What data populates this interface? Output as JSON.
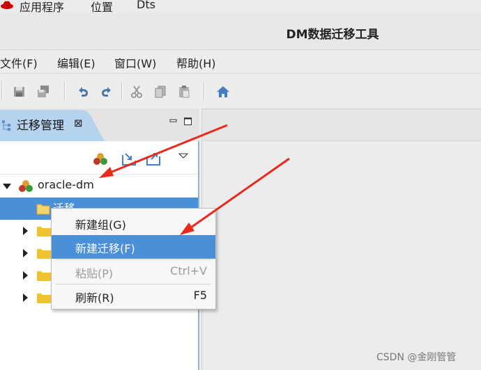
{
  "system_bar": {
    "applications": "应用程序",
    "places": "位置",
    "app_name": "Dts"
  },
  "window": {
    "title": "DM数据迁移工具"
  },
  "menubar": {
    "items": [
      "文件(F)",
      "编辑(E)",
      "窗口(W)",
      "帮助(H)"
    ]
  },
  "toolbar": {
    "icons": [
      "save-icon",
      "save-all-icon",
      "undo-icon",
      "redo-icon",
      "cut-icon",
      "copy-icon",
      "paste-icon",
      "home-icon"
    ]
  },
  "view": {
    "tab_label": "迁移管理",
    "tab_close": "⊠"
  },
  "tree": {
    "root_label": "oracle-dm",
    "selected_child_label": "迁移"
  },
  "context_menu": {
    "items": [
      {
        "label": "新建组(G)",
        "shortcut": ""
      },
      {
        "label": "新建迁移(F)",
        "shortcut": ""
      },
      {
        "label": "粘贴(P)",
        "shortcut": "Ctrl+V"
      },
      {
        "label": "刷新(R)",
        "shortcut": "F5"
      }
    ]
  },
  "watermark": "CSDN @金刚管管",
  "colors": {
    "selection": "#4a90d9",
    "tab_active": "#b5d3ee",
    "annotation_arrow": "#e8291c"
  }
}
